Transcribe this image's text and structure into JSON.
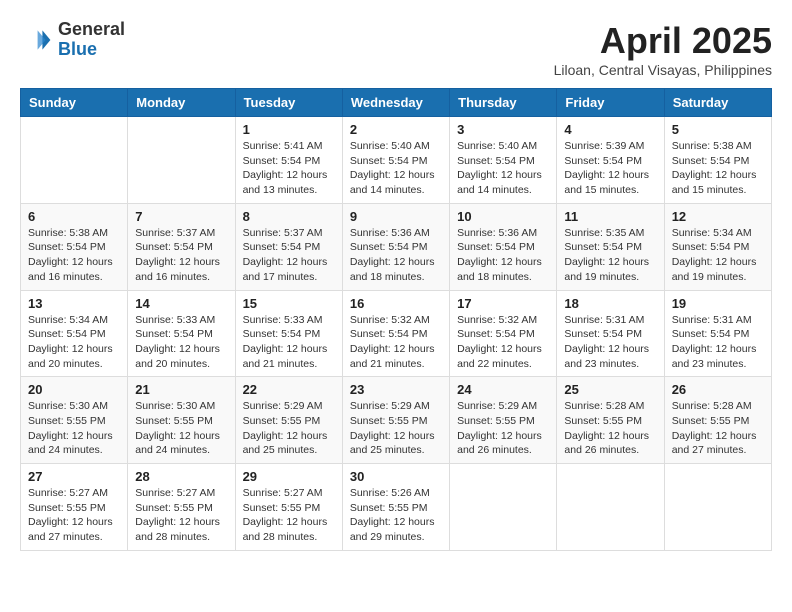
{
  "header": {
    "logo_general": "General",
    "logo_blue": "Blue",
    "month_year": "April 2025",
    "location": "Liloan, Central Visayas, Philippines"
  },
  "calendar": {
    "days_of_week": [
      "Sunday",
      "Monday",
      "Tuesday",
      "Wednesday",
      "Thursday",
      "Friday",
      "Saturday"
    ],
    "weeks": [
      [
        {
          "day": "",
          "info": ""
        },
        {
          "day": "",
          "info": ""
        },
        {
          "day": "1",
          "info": "Sunrise: 5:41 AM\nSunset: 5:54 PM\nDaylight: 12 hours\nand 13 minutes."
        },
        {
          "day": "2",
          "info": "Sunrise: 5:40 AM\nSunset: 5:54 PM\nDaylight: 12 hours\nand 14 minutes."
        },
        {
          "day": "3",
          "info": "Sunrise: 5:40 AM\nSunset: 5:54 PM\nDaylight: 12 hours\nand 14 minutes."
        },
        {
          "day": "4",
          "info": "Sunrise: 5:39 AM\nSunset: 5:54 PM\nDaylight: 12 hours\nand 15 minutes."
        },
        {
          "day": "5",
          "info": "Sunrise: 5:38 AM\nSunset: 5:54 PM\nDaylight: 12 hours\nand 15 minutes."
        }
      ],
      [
        {
          "day": "6",
          "info": "Sunrise: 5:38 AM\nSunset: 5:54 PM\nDaylight: 12 hours\nand 16 minutes."
        },
        {
          "day": "7",
          "info": "Sunrise: 5:37 AM\nSunset: 5:54 PM\nDaylight: 12 hours\nand 16 minutes."
        },
        {
          "day": "8",
          "info": "Sunrise: 5:37 AM\nSunset: 5:54 PM\nDaylight: 12 hours\nand 17 minutes."
        },
        {
          "day": "9",
          "info": "Sunrise: 5:36 AM\nSunset: 5:54 PM\nDaylight: 12 hours\nand 18 minutes."
        },
        {
          "day": "10",
          "info": "Sunrise: 5:36 AM\nSunset: 5:54 PM\nDaylight: 12 hours\nand 18 minutes."
        },
        {
          "day": "11",
          "info": "Sunrise: 5:35 AM\nSunset: 5:54 PM\nDaylight: 12 hours\nand 19 minutes."
        },
        {
          "day": "12",
          "info": "Sunrise: 5:34 AM\nSunset: 5:54 PM\nDaylight: 12 hours\nand 19 minutes."
        }
      ],
      [
        {
          "day": "13",
          "info": "Sunrise: 5:34 AM\nSunset: 5:54 PM\nDaylight: 12 hours\nand 20 minutes."
        },
        {
          "day": "14",
          "info": "Sunrise: 5:33 AM\nSunset: 5:54 PM\nDaylight: 12 hours\nand 20 minutes."
        },
        {
          "day": "15",
          "info": "Sunrise: 5:33 AM\nSunset: 5:54 PM\nDaylight: 12 hours\nand 21 minutes."
        },
        {
          "day": "16",
          "info": "Sunrise: 5:32 AM\nSunset: 5:54 PM\nDaylight: 12 hours\nand 21 minutes."
        },
        {
          "day": "17",
          "info": "Sunrise: 5:32 AM\nSunset: 5:54 PM\nDaylight: 12 hours\nand 22 minutes."
        },
        {
          "day": "18",
          "info": "Sunrise: 5:31 AM\nSunset: 5:54 PM\nDaylight: 12 hours\nand 23 minutes."
        },
        {
          "day": "19",
          "info": "Sunrise: 5:31 AM\nSunset: 5:54 PM\nDaylight: 12 hours\nand 23 minutes."
        }
      ],
      [
        {
          "day": "20",
          "info": "Sunrise: 5:30 AM\nSunset: 5:55 PM\nDaylight: 12 hours\nand 24 minutes."
        },
        {
          "day": "21",
          "info": "Sunrise: 5:30 AM\nSunset: 5:55 PM\nDaylight: 12 hours\nand 24 minutes."
        },
        {
          "day": "22",
          "info": "Sunrise: 5:29 AM\nSunset: 5:55 PM\nDaylight: 12 hours\nand 25 minutes."
        },
        {
          "day": "23",
          "info": "Sunrise: 5:29 AM\nSunset: 5:55 PM\nDaylight: 12 hours\nand 25 minutes."
        },
        {
          "day": "24",
          "info": "Sunrise: 5:29 AM\nSunset: 5:55 PM\nDaylight: 12 hours\nand 26 minutes."
        },
        {
          "day": "25",
          "info": "Sunrise: 5:28 AM\nSunset: 5:55 PM\nDaylight: 12 hours\nand 26 minutes."
        },
        {
          "day": "26",
          "info": "Sunrise: 5:28 AM\nSunset: 5:55 PM\nDaylight: 12 hours\nand 27 minutes."
        }
      ],
      [
        {
          "day": "27",
          "info": "Sunrise: 5:27 AM\nSunset: 5:55 PM\nDaylight: 12 hours\nand 27 minutes."
        },
        {
          "day": "28",
          "info": "Sunrise: 5:27 AM\nSunset: 5:55 PM\nDaylight: 12 hours\nand 28 minutes."
        },
        {
          "day": "29",
          "info": "Sunrise: 5:27 AM\nSunset: 5:55 PM\nDaylight: 12 hours\nand 28 minutes."
        },
        {
          "day": "30",
          "info": "Sunrise: 5:26 AM\nSunset: 5:55 PM\nDaylight: 12 hours\nand 29 minutes."
        },
        {
          "day": "",
          "info": ""
        },
        {
          "day": "",
          "info": ""
        },
        {
          "day": "",
          "info": ""
        }
      ]
    ]
  }
}
